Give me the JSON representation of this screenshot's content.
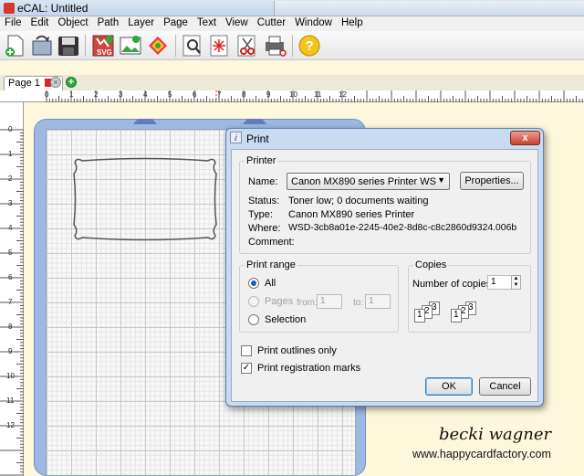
{
  "window": {
    "title": "eCAL: Untitled"
  },
  "menu": [
    "File",
    "Edit",
    "Object",
    "Path",
    "Layer",
    "Page",
    "Text",
    "View",
    "Cutter",
    "Window",
    "Help"
  ],
  "toolbar": {
    "icons": [
      "new-file-icon",
      "open-file-icon",
      "save-icon",
      "import-svg-icon",
      "import-image-icon",
      "trace-icon",
      "zoom-icon",
      "laser-cut-icon",
      "cut-icon",
      "print-cut-icon",
      "help-icon"
    ],
    "svg_label": "SVG",
    "help_glyph": "?"
  },
  "tabs": {
    "page_label": "Page 1"
  },
  "rulers": {
    "h": [
      "0",
      "1",
      "2",
      "3",
      "4",
      "5",
      "6",
      "7",
      "8",
      "9",
      "10",
      "11",
      "12"
    ],
    "v": [
      "0",
      "1",
      "2",
      "3",
      "4",
      "5",
      "6",
      "7",
      "8",
      "9",
      "10",
      "11",
      "12"
    ]
  },
  "dialog": {
    "title": "Print",
    "close_label": "x",
    "printer": {
      "group": "Printer",
      "name_label": "Name:",
      "name_value": "Canon MX890 series Printer WS",
      "properties_label": "Properties...",
      "status_label": "Status:",
      "status_value": "Toner low; 0 documents waiting",
      "type_label": "Type:",
      "type_value": "Canon MX890 series Printer",
      "where_label": "Where:",
      "where_value": "WSD-3cb8a01e-2245-40e2-8d8c-c8c2860d9324.006b",
      "comment_label": "Comment:"
    },
    "range": {
      "group": "Print range",
      "all_label": "All",
      "pages_label": "Pages",
      "from_label": "from:",
      "from_value": "1",
      "to_label": "to:",
      "to_value": "1",
      "selection_label": "Selection",
      "selected": "All"
    },
    "copies": {
      "group": "Copies",
      "number_label": "Number of copies:",
      "number_value": "1",
      "collate_pages": [
        "1",
        "2",
        "3"
      ]
    },
    "options": {
      "outlines_label": "Print outlines only",
      "outlines_checked": false,
      "registration_label": "Print registration marks",
      "registration_checked": true
    },
    "ok_label": "OK",
    "cancel_label": "Cancel"
  },
  "watermark": {
    "signature": "becki wagner",
    "url": "www.happycardfactory.com"
  },
  "colors": {
    "mat": "#9eb8e3",
    "canvas_bg": "#fdf8dc",
    "dialog_frame": "#c8dbf1",
    "accent_blue": "#1c58c4"
  }
}
